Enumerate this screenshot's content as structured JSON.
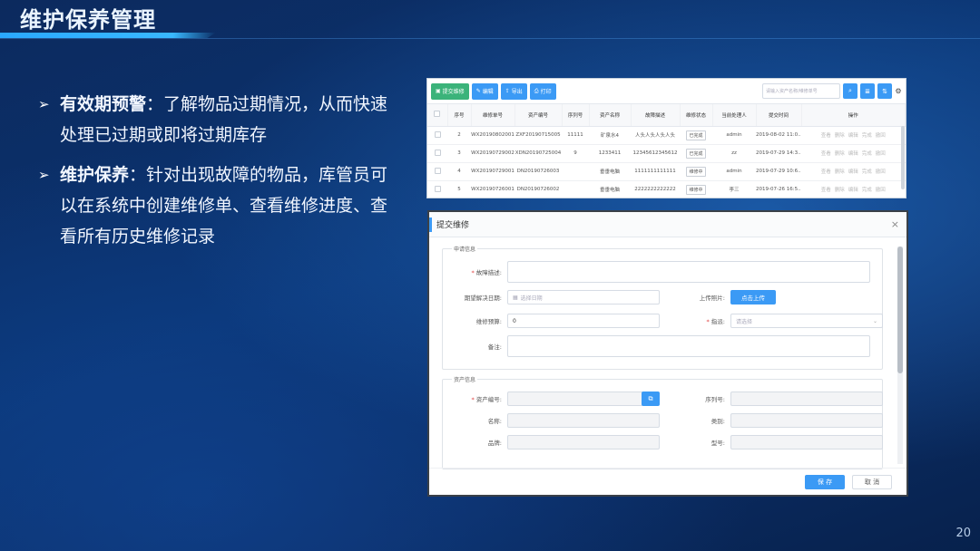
{
  "slide": {
    "title": "维护保养管理",
    "page_number": "20",
    "bullets": [
      {
        "heading": "有效期预警",
        "sep": "：",
        "text": "了解物品过期情况，从而快速处理已过期或即将过期库存"
      },
      {
        "heading": "维护保养",
        "sep": "：",
        "text": "针对出现故障的物品，库管员可以在系统中创建维修单、查看维修进度、查看所有历史维修记录"
      }
    ]
  },
  "list_screen": {
    "toolbar": {
      "submit_label": "提交维修",
      "edit_label": "编辑",
      "export_label": "导出",
      "print_label": "打印",
      "search_placeholder": "请输入资产名称/维修单号",
      "gear_glyph": "⚙"
    },
    "columns": [
      "",
      "序号",
      "维修单号",
      "资产编号",
      "序列号",
      "资产名称",
      "故障描述",
      "维修状态",
      "当前处理人",
      "提交时间",
      "操作"
    ],
    "rows": [
      {
        "seq": "2",
        "order": "WX20190802001",
        "asset_no": "ZXF20190715005",
        "serial": "11111",
        "name": "矿泉水4",
        "desc": "人头人头人头人头",
        "status": "已完成",
        "handler": "admin",
        "handler_color": "#e06b2d",
        "time": "2019-08-02 11:0..."
      },
      {
        "seq": "3",
        "order": "WX20190729002",
        "asset_no": "XDN20190725004",
        "serial": "9",
        "name": "1233411",
        "desc": "12345612345612",
        "status": "已完成",
        "handler": "zz",
        "handler_color": "#e06b2d",
        "time": "2019-07-29 14:3..."
      },
      {
        "seq": "4",
        "order": "WX20190729001",
        "asset_no": "DN20190726003",
        "serial": "",
        "name": "垂垂电脑",
        "desc": "1111111111111",
        "status": "维修中",
        "handler": "admin",
        "handler_color": "#e06b2d",
        "time": "2019-07-29 10:6..."
      },
      {
        "seq": "5",
        "order": "WX20190726001",
        "asset_no": "DN20190726002",
        "serial": "",
        "name": "垂垂电脑",
        "desc": "2222222222222",
        "status": "维修中",
        "handler": "李三",
        "handler_color": "#e06b2d",
        "time": "2019-07-26 16:5..."
      }
    ],
    "ops": [
      "查看",
      "删除",
      "编辑",
      "完成",
      "撤回"
    ]
  },
  "dialog": {
    "title": "提交维修",
    "close_glyph": "×",
    "apply_section": "申请信息",
    "asset_section": "资产信息",
    "fault_label": "故障描述:",
    "expected_date_label": "期望解决日期:",
    "date_placeholder": "选择日期",
    "upload_label": "上传照片:",
    "upload_button": "点击上传",
    "budget_label": "维修预算:",
    "budget_value": "0",
    "assign_label": "指派:",
    "assign_placeholder": "请选择",
    "note_label": "备注:",
    "asset_no_label": "资产编号:",
    "serial_label": "序列号:",
    "name_label": "名称:",
    "category_label": "类别:",
    "brand_label": "品牌:",
    "model_label": "型号:",
    "save_button": "保 存",
    "cancel_button": "取 消"
  }
}
